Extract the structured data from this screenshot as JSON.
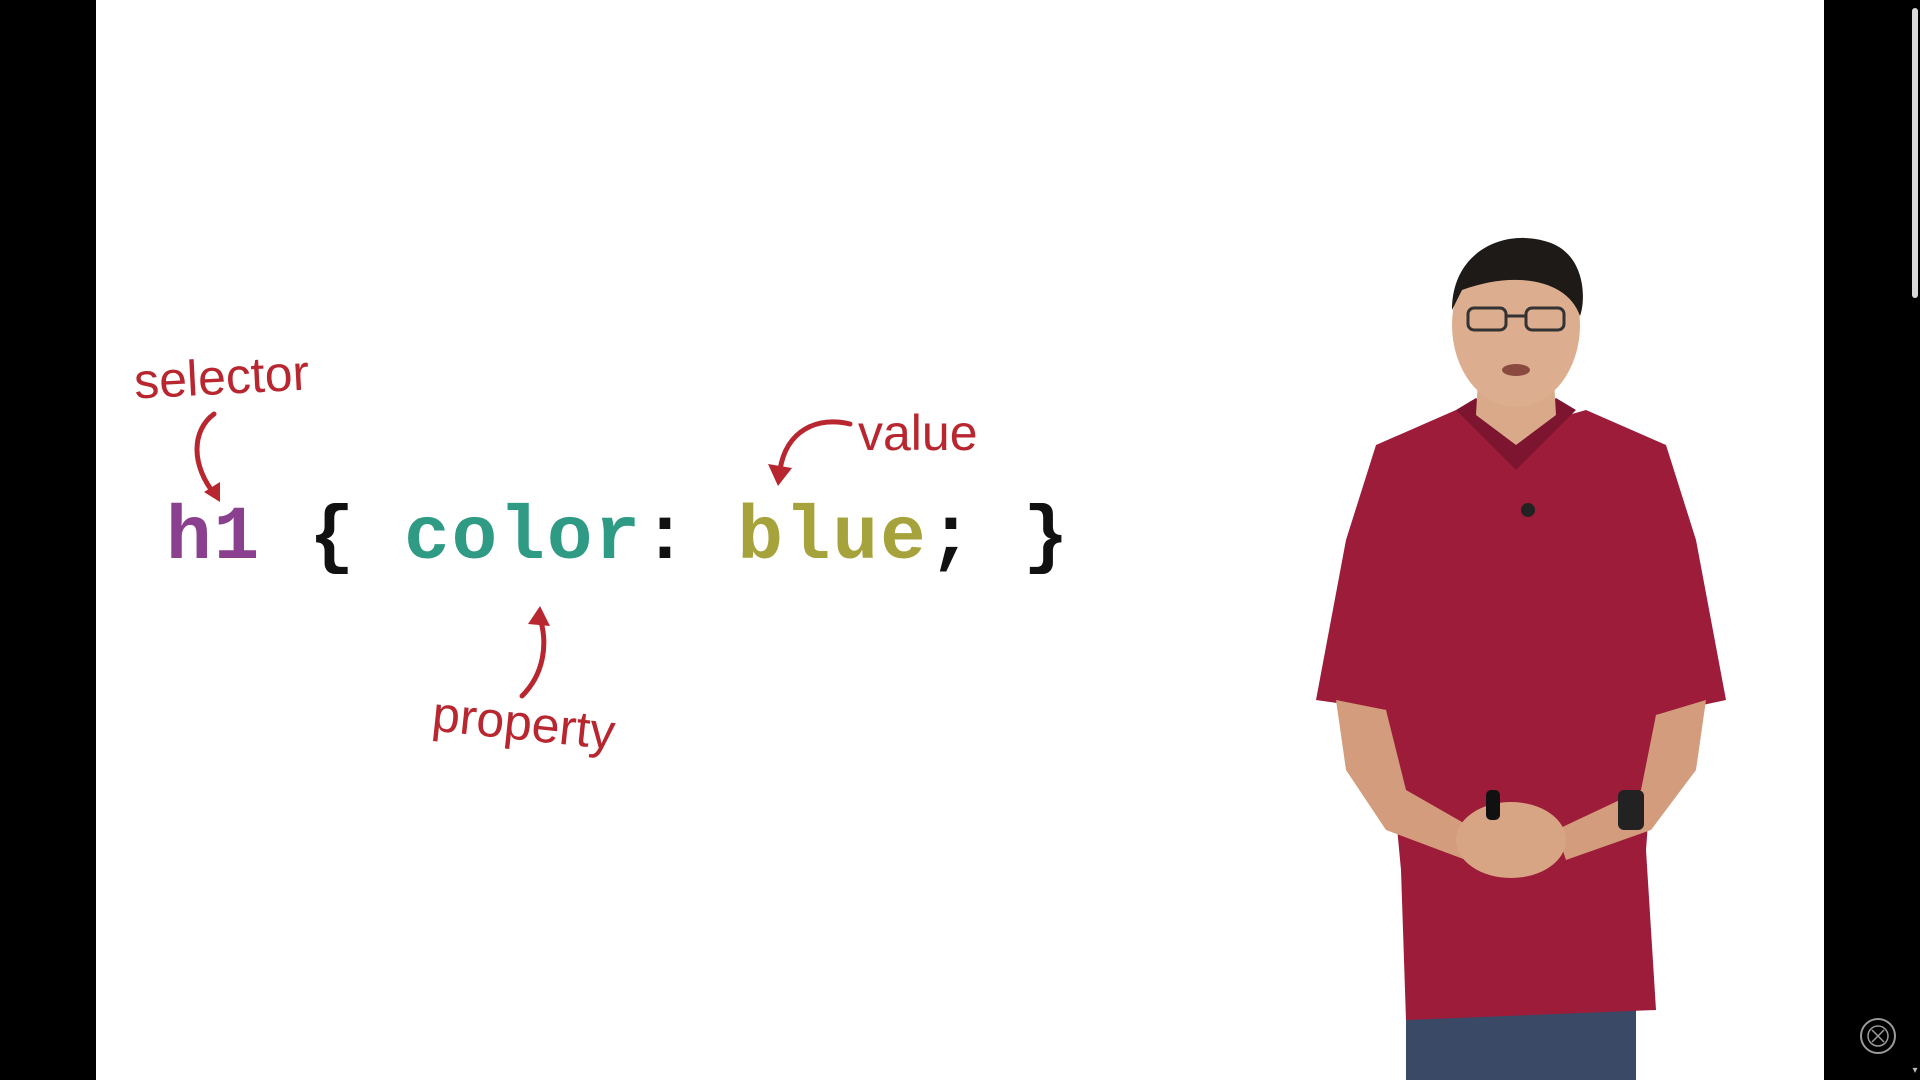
{
  "slide": {
    "code": {
      "selector": "h1",
      "open_brace": "{",
      "property": "color",
      "colon": ":",
      "value": "blue",
      "semicolon": ";",
      "close_brace": "}"
    },
    "annotations": {
      "selector": "selector",
      "value": "value",
      "property": "property"
    }
  },
  "colors": {
    "selector": "#8b3f8f",
    "property": "#2f9b84",
    "value": "#a7a33c",
    "annotation": "#b8262f",
    "shirt": "#9c1c3a"
  },
  "icons": {
    "arrows": "curved-arrow-icon",
    "watermark": "channel-watermark-icon",
    "scroll": "chevron-down-icon"
  }
}
